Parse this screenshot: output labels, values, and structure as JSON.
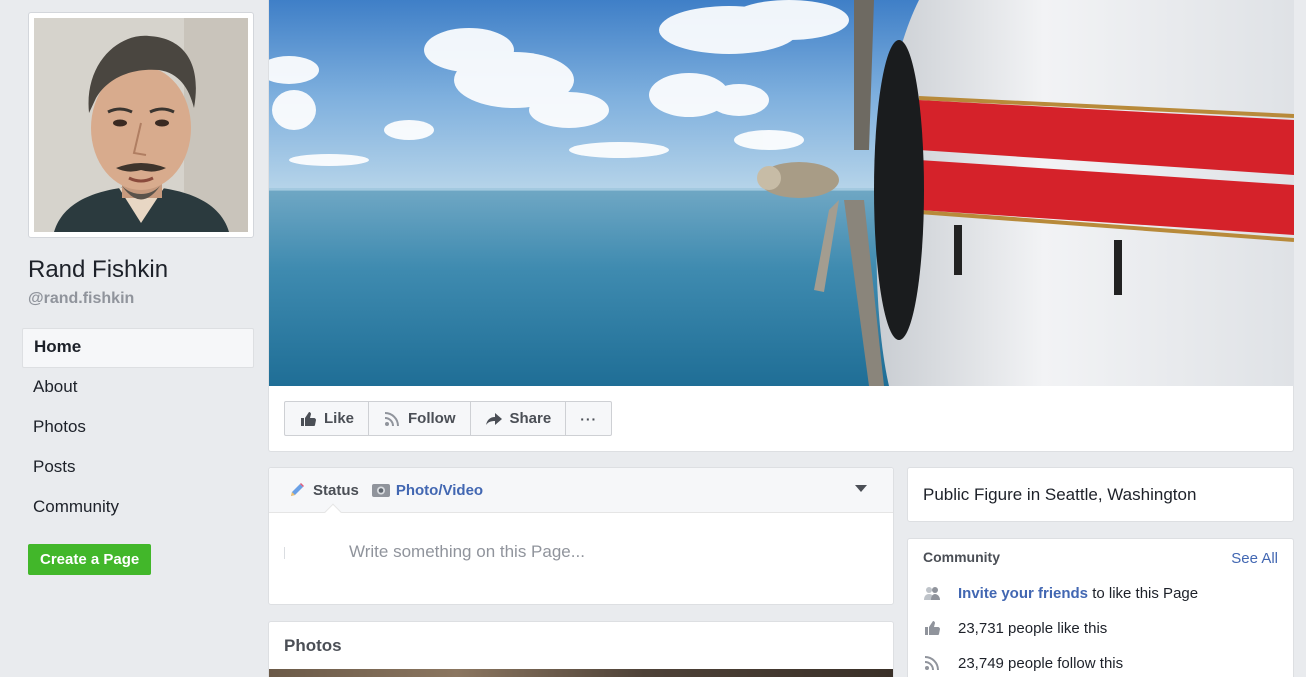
{
  "profile": {
    "name": "Rand Fishkin",
    "handle": "@rand.fishkin"
  },
  "nav": {
    "items": [
      {
        "label": "Home",
        "active": true
      },
      {
        "label": "About"
      },
      {
        "label": "Photos"
      },
      {
        "label": "Posts"
      },
      {
        "label": "Community"
      }
    ],
    "create_page": "Create a Page"
  },
  "actions": {
    "like": "Like",
    "follow": "Follow",
    "share": "Share",
    "more": "···"
  },
  "composer": {
    "status_tab": "Status",
    "photo_tab": "Photo/Video",
    "placeholder": "Write something on this Page..."
  },
  "photos": {
    "title": "Photos"
  },
  "about": {
    "text": "Public Figure in Seattle, Washington"
  },
  "community": {
    "title": "Community",
    "see_all": "See All",
    "invite_link": "Invite your friends",
    "invite_rest": " to like this Page",
    "likes": "23,731 people like this",
    "follows": "23,749 people follow this"
  },
  "colors": {
    "link": "#4267b2",
    "create_button": "#42b72a",
    "background": "#e9ebee"
  }
}
